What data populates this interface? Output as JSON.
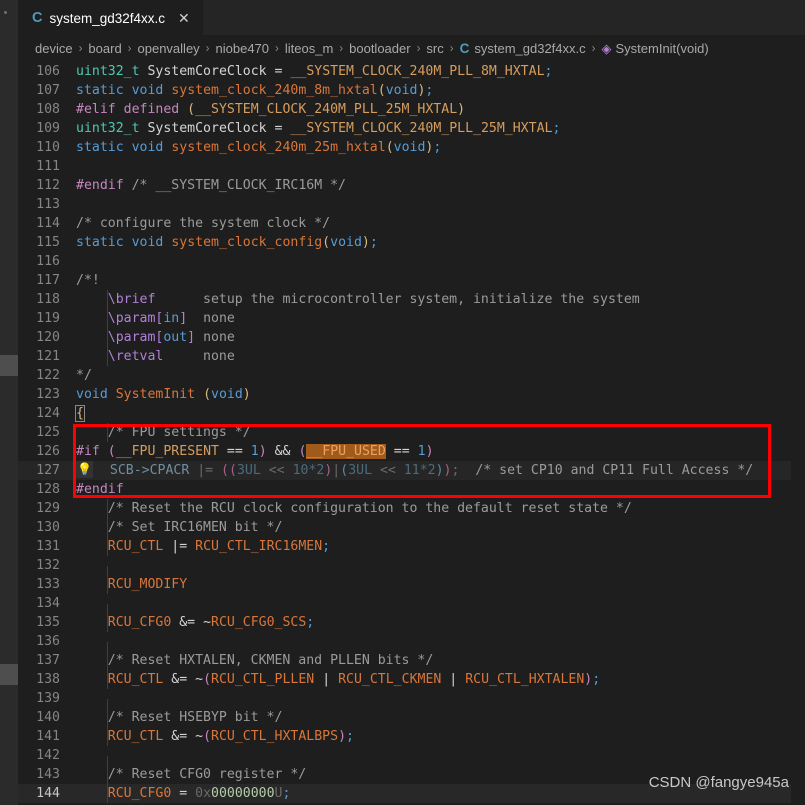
{
  "window": {
    "theme": "vscode-dark",
    "accent_red": "#ff0000",
    "editor_bg": "#1e1e1e",
    "tabbar_bg": "#252526"
  },
  "tabbar": {
    "tabs": [
      {
        "lang_icon": "C",
        "title": "system_gd32f4xx.c",
        "close_icon": "✕",
        "active": true
      }
    ]
  },
  "breadcrumbs": {
    "separator": "›",
    "items": [
      {
        "label": "device",
        "icon": ""
      },
      {
        "label": "board",
        "icon": ""
      },
      {
        "label": "openvalley",
        "icon": ""
      },
      {
        "label": "niobe470",
        "icon": ""
      },
      {
        "label": "liteos_m",
        "icon": ""
      },
      {
        "label": "bootloader",
        "icon": ""
      },
      {
        "label": "src",
        "icon": ""
      },
      {
        "label": "system_gd32f4xx.c",
        "icon": "c-file-icon"
      },
      {
        "label": "SystemInit(void)",
        "icon": "method-symbol-icon"
      }
    ]
  },
  "editor": {
    "first_line": 106,
    "active_line": 144,
    "bulb_icon": "💡",
    "lines": [
      {
        "n": 106,
        "text": "uint32_t SystemCoreClock = __SYSTEM_CLOCK_240M_PLL_8M_HXTAL;"
      },
      {
        "n": 107,
        "text": "static void system_clock_240m_8m_hxtal(void);"
      },
      {
        "n": 108,
        "text": "#elif defined (__SYSTEM_CLOCK_240M_PLL_25M_HXTAL)"
      },
      {
        "n": 109,
        "text": "uint32_t SystemCoreClock = __SYSTEM_CLOCK_240M_PLL_25M_HXTAL;"
      },
      {
        "n": 110,
        "text": "static void system_clock_240m_25m_hxtal(void);"
      },
      {
        "n": 111,
        "text": ""
      },
      {
        "n": 112,
        "text": "#endif /* __SYSTEM_CLOCK_IRC16M */"
      },
      {
        "n": 113,
        "text": ""
      },
      {
        "n": 114,
        "text": "/* configure the system clock */"
      },
      {
        "n": 115,
        "text": "static void system_clock_config(void);"
      },
      {
        "n": 116,
        "text": ""
      },
      {
        "n": 117,
        "text": "/*!"
      },
      {
        "n": 118,
        "text": "    \\brief      setup the microcontroller system, initialize the system"
      },
      {
        "n": 119,
        "text": "    \\param[in]  none"
      },
      {
        "n": 120,
        "text": "    \\param[out] none"
      },
      {
        "n": 121,
        "text": "    \\retval     none"
      },
      {
        "n": 122,
        "text": "*/"
      },
      {
        "n": 123,
        "text": "void SystemInit (void)"
      },
      {
        "n": 124,
        "text": "{"
      },
      {
        "n": 125,
        "text": "    /* FPU settings */"
      },
      {
        "n": 126,
        "text": "#if (__FPU_PRESENT == 1) && (__FPU_USED == 1)"
      },
      {
        "n": 127,
        "text": "    SCB->CPACR |= ((3UL << 10*2)|(3UL << 11*2));  /* set CP10 and CP11 Full Access */"
      },
      {
        "n": 128,
        "text": "#endif"
      },
      {
        "n": 129,
        "text": "    /* Reset the RCU clock configuration to the default reset state */"
      },
      {
        "n": 130,
        "text": "    /* Set IRC16MEN bit */"
      },
      {
        "n": 131,
        "text": "    RCU_CTL |= RCU_CTL_IRC16MEN;"
      },
      {
        "n": 132,
        "text": ""
      },
      {
        "n": 133,
        "text": "    RCU_MODIFY"
      },
      {
        "n": 134,
        "text": ""
      },
      {
        "n": 135,
        "text": "    RCU_CFG0 &= ~RCU_CFG0_SCS;"
      },
      {
        "n": 136,
        "text": ""
      },
      {
        "n": 137,
        "text": "    /* Reset HXTALEN, CKMEN and PLLEN bits */"
      },
      {
        "n": 138,
        "text": "    RCU_CTL &= ~(RCU_CTL_PLLEN | RCU_CTL_CKMEN | RCU_CTL_HXTALEN);"
      },
      {
        "n": 139,
        "text": ""
      },
      {
        "n": 140,
        "text": "    /* Reset HSEBYP bit */"
      },
      {
        "n": 141,
        "text": "    RCU_CTL &= ~(RCU_CTL_HXTALBPS);"
      },
      {
        "n": 142,
        "text": ""
      },
      {
        "n": 143,
        "text": "    /* Reset CFG0 register */"
      },
      {
        "n": 144,
        "text": "    RCU_CFG0 = 0x00000000U;"
      }
    ],
    "selection": {
      "token": "__FPU_USED",
      "line": 126,
      "highlight_color": "#a05a19"
    }
  },
  "annotation": {
    "type": "red-rectangle",
    "covers_lines": "125-128",
    "color": "#ff0000"
  },
  "watermark": {
    "text": "CSDN @fangye945a"
  }
}
